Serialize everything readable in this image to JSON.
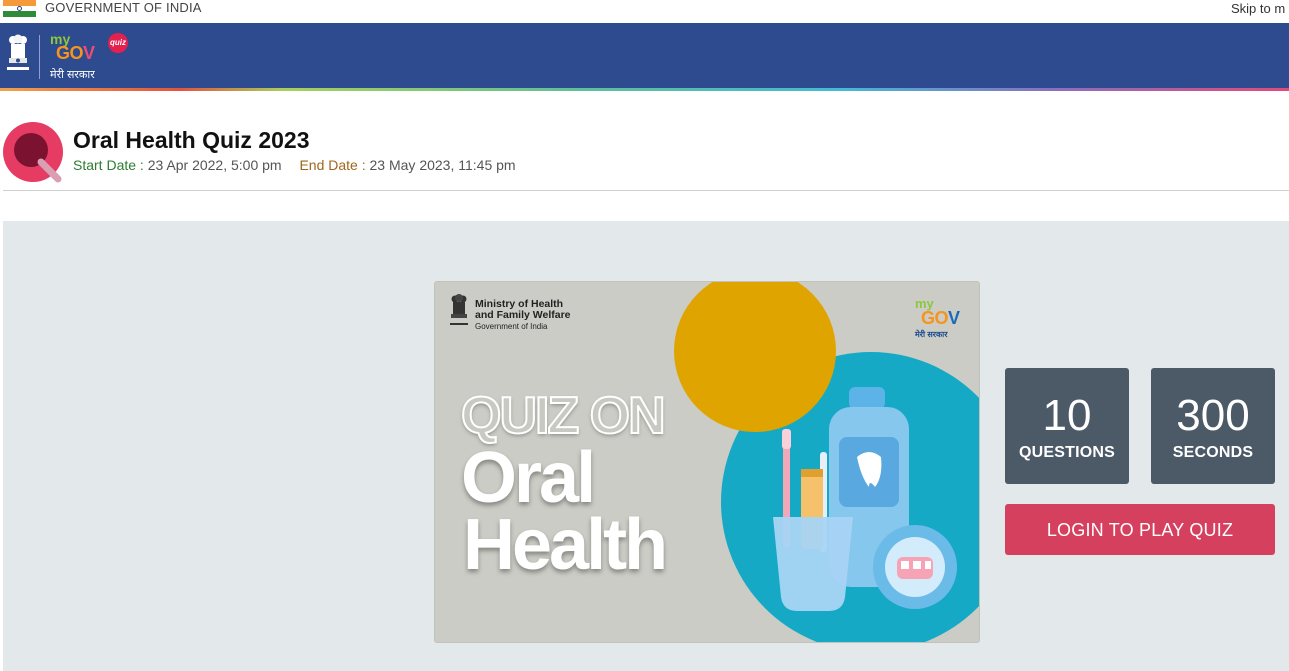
{
  "gov_strip": {
    "label": "GOVERNMENT OF INDIA",
    "skip_link": "Skip to m"
  },
  "header": {
    "logo_my": "my",
    "logo_gov_prefix": "GO",
    "logo_gov_v": "V",
    "logo_quiz": "quiz",
    "logo_hindi": "मेरी सरकार",
    "emblem_caption": "सत्यमेव जयते"
  },
  "quiz": {
    "title": "Oral Health Quiz 2023",
    "start_label": "Start Date :",
    "start_value": "23 Apr 2022, 5:00 pm",
    "end_label": "End Date :",
    "end_value": "23 May 2023, 11:45 pm"
  },
  "banner": {
    "ministry_line1": "Ministry of Health",
    "ministry_line2": "and Family Welfare",
    "ministry_line3": "Government of India",
    "logo_my": "my",
    "logo_gov_prefix": "GO",
    "logo_gov_v": "V",
    "logo_hindi": "मेरी सरकार",
    "heading_line1": "QUIZ ON",
    "heading_line2": "Oral",
    "heading_line3": "Health"
  },
  "stats": {
    "questions_value": "10",
    "questions_label": "QUESTIONS",
    "seconds_value": "300",
    "seconds_label": "SECONDS"
  },
  "actions": {
    "login_label": "LOGIN TO PLAY QUIZ"
  },
  "colors": {
    "header_blue": "#2d4b8e",
    "stat_card": "#4c5967",
    "login_button": "#d6405f",
    "panel_bg": "#e3e8ea",
    "start_label": "#2e7d32",
    "end_label": "#a0661b"
  }
}
